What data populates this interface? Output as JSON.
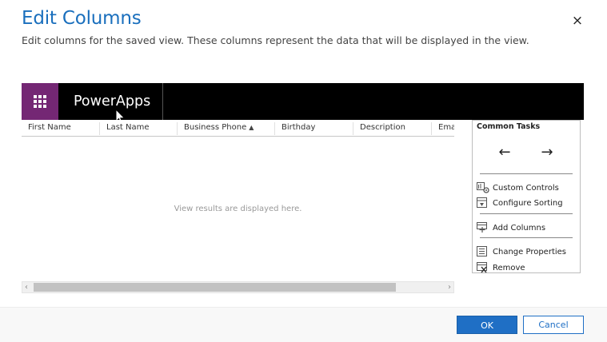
{
  "dialog": {
    "title": "Edit Columns",
    "subtitle": "Edit columns for the saved view. These columns represent the data that will be displayed in the view.",
    "close_label": "×"
  },
  "app_header": {
    "app_name": "PowerApps",
    "waffle_icon": "app-launcher-icon",
    "colors": {
      "header_bg": "#000000",
      "waffle_bg": "#742774"
    }
  },
  "grid": {
    "columns": [
      {
        "label": "First Name",
        "sorted": false
      },
      {
        "label": "Last Name",
        "sorted": false
      },
      {
        "label": "Business Phone",
        "sorted": true,
        "sort_glyph": "▲"
      },
      {
        "label": "Birthday",
        "sorted": false
      },
      {
        "label": "Description",
        "sorted": false
      },
      {
        "label": "Ema",
        "sorted": false
      }
    ],
    "empty_message": "View results are displayed here.",
    "scroll_left": "‹",
    "scroll_right": "›"
  },
  "common_tasks": {
    "title": "Common Tasks",
    "move_left_glyph": "←",
    "move_right_glyph": "→",
    "items": [
      {
        "label": "Custom Controls",
        "icon": "custom-controls-icon"
      },
      {
        "label": "Configure Sorting",
        "icon": "configure-sorting-icon"
      },
      {
        "label": "Add Columns",
        "icon": "add-columns-icon"
      },
      {
        "label": "Change Properties",
        "icon": "change-properties-icon"
      },
      {
        "label": "Remove",
        "icon": "remove-icon"
      }
    ]
  },
  "footer": {
    "ok_label": "OK",
    "cancel_label": "Cancel",
    "colors": {
      "primary": "#1f6fc5"
    }
  }
}
